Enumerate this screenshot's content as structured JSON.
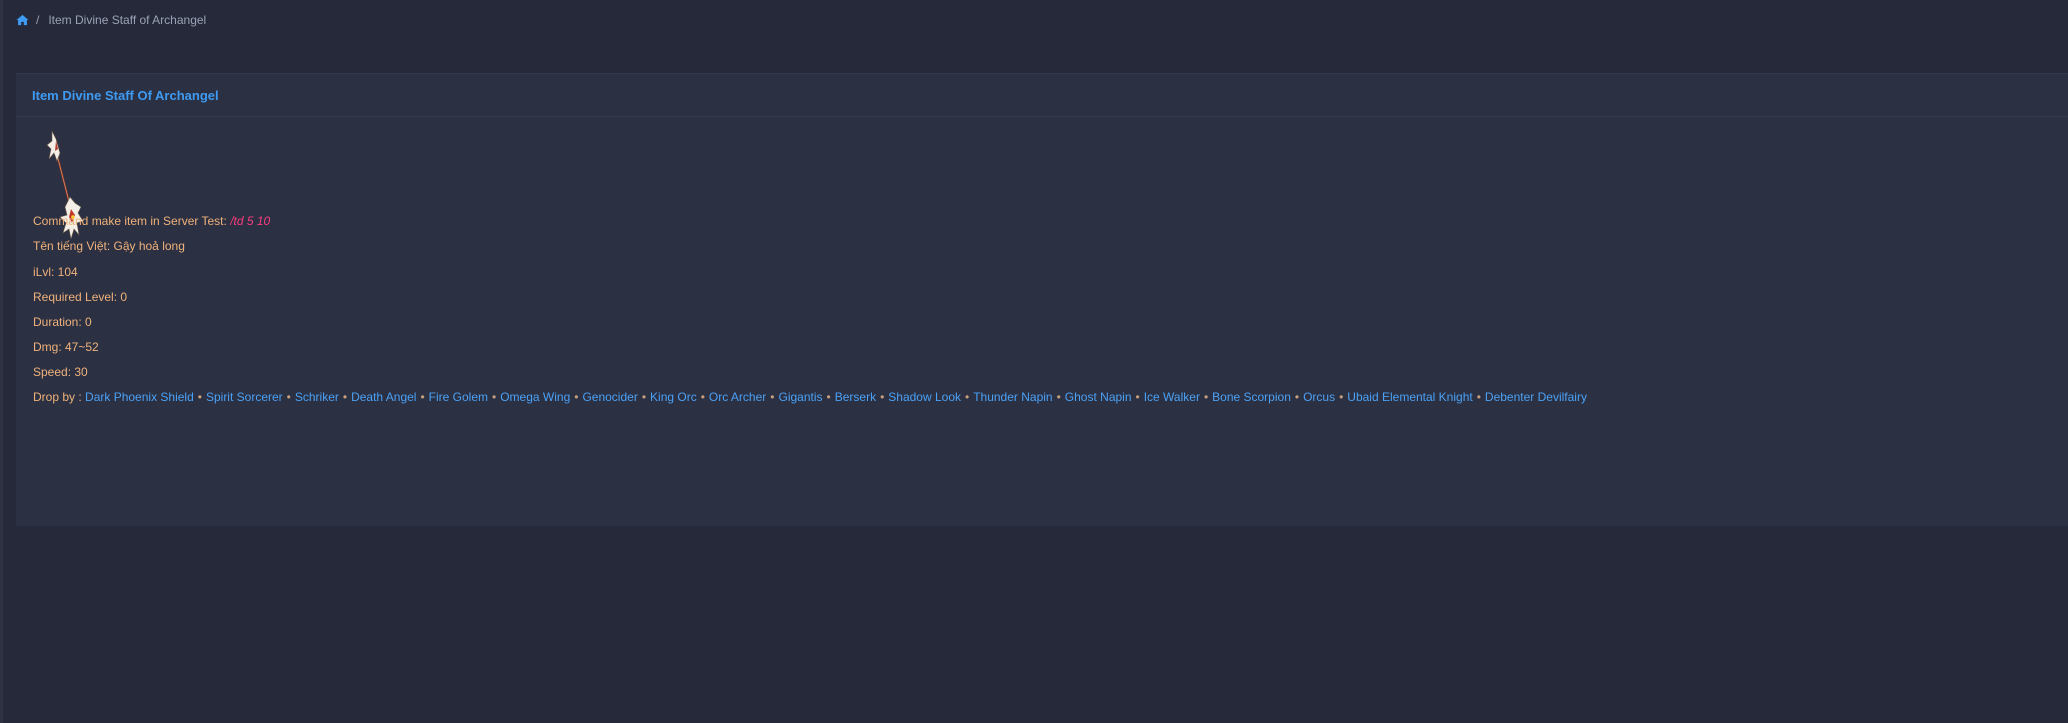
{
  "breadcrumb": {
    "home_icon": "home-icon",
    "separator": "/",
    "current": "Item Divine Staff of Archangel"
  },
  "card": {
    "title": "Item Divine Staff Of Archangel",
    "item_image": "divine-staff-of-archangel-icon",
    "command": {
      "label": "Command make item in Server Test: ",
      "value": "/td 5 10"
    },
    "vietnamese_name": "Tên tiếng Việt: Gậy hoả long",
    "ilvl": "iLvl: 104",
    "required_level": "Required Level: 0",
    "duration": "Duration: 0",
    "dmg": "Dmg: 47~52",
    "speed": "Speed: 30",
    "drop_by": {
      "label": "Drop by : ",
      "separator": "•",
      "monsters": [
        "Dark Phoenix Shield",
        "Spirit Sorcerer",
        "Schriker",
        "Death Angel",
        "Fire Golem",
        "Omega Wing",
        "Genocider",
        "King Orc",
        "Orc Archer",
        "Gigantis",
        "Berserk",
        "Shadow Look",
        "Thunder Napin",
        "Ghost Napin",
        "Ice Walker",
        "Bone Scorpion",
        "Orcus",
        "Ubaid Elemental Knight",
        "Debenter Devilfairy"
      ]
    }
  },
  "colors": {
    "background": "#252939",
    "card": "#2b3043",
    "accent": "#3e9bf3",
    "text": "#f0b27a",
    "command": "#ff3b7f"
  }
}
